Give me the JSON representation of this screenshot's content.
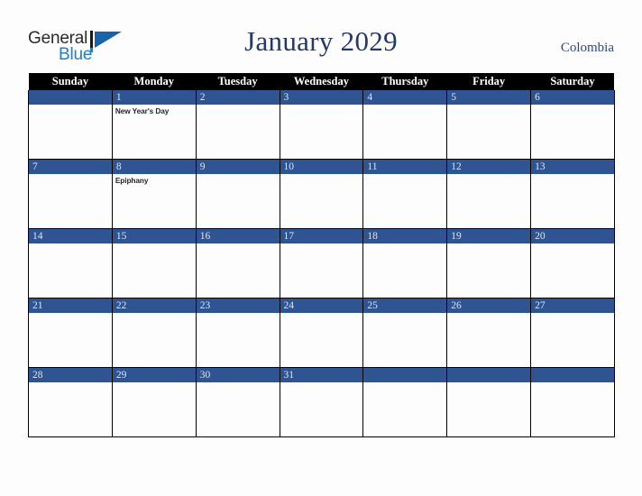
{
  "brand": {
    "name_part1": "General",
    "name_part2": "Blue",
    "logo_icon": "triangle-flag-icon"
  },
  "header": {
    "title": "January 2029",
    "country": "Colombia"
  },
  "calendar": {
    "weekday_headers": [
      "Sunday",
      "Monday",
      "Tuesday",
      "Wednesday",
      "Thursday",
      "Friday",
      "Saturday"
    ],
    "colors": {
      "header_bg": "#000000",
      "header_text": "#ffffff",
      "daybar_bg": "#2e5494",
      "daybar_text": "#dfe5f0",
      "title_text": "#243a66",
      "country_text": "#2e4a7d",
      "page_bg": "#fdfdfd",
      "grid_border": "#000000",
      "brand_blue": "#1b7fd4",
      "brand_dark": "#2b2b2b"
    },
    "weeks": [
      [
        {
          "day": "",
          "events": []
        },
        {
          "day": "1",
          "events": [
            "New Year's Day"
          ]
        },
        {
          "day": "2",
          "events": []
        },
        {
          "day": "3",
          "events": []
        },
        {
          "day": "4",
          "events": []
        },
        {
          "day": "5",
          "events": []
        },
        {
          "day": "6",
          "events": []
        }
      ],
      [
        {
          "day": "7",
          "events": []
        },
        {
          "day": "8",
          "events": [
            "Epiphany"
          ]
        },
        {
          "day": "9",
          "events": []
        },
        {
          "day": "10",
          "events": []
        },
        {
          "day": "11",
          "events": []
        },
        {
          "day": "12",
          "events": []
        },
        {
          "day": "13",
          "events": []
        }
      ],
      [
        {
          "day": "14",
          "events": []
        },
        {
          "day": "15",
          "events": []
        },
        {
          "day": "16",
          "events": []
        },
        {
          "day": "17",
          "events": []
        },
        {
          "day": "18",
          "events": []
        },
        {
          "day": "19",
          "events": []
        },
        {
          "day": "20",
          "events": []
        }
      ],
      [
        {
          "day": "21",
          "events": []
        },
        {
          "day": "22",
          "events": []
        },
        {
          "day": "23",
          "events": []
        },
        {
          "day": "24",
          "events": []
        },
        {
          "day": "25",
          "events": []
        },
        {
          "day": "26",
          "events": []
        },
        {
          "day": "27",
          "events": []
        }
      ],
      [
        {
          "day": "28",
          "events": []
        },
        {
          "day": "29",
          "events": []
        },
        {
          "day": "30",
          "events": []
        },
        {
          "day": "31",
          "events": []
        },
        {
          "day": "",
          "events": []
        },
        {
          "day": "",
          "events": []
        },
        {
          "day": "",
          "events": []
        }
      ]
    ]
  }
}
